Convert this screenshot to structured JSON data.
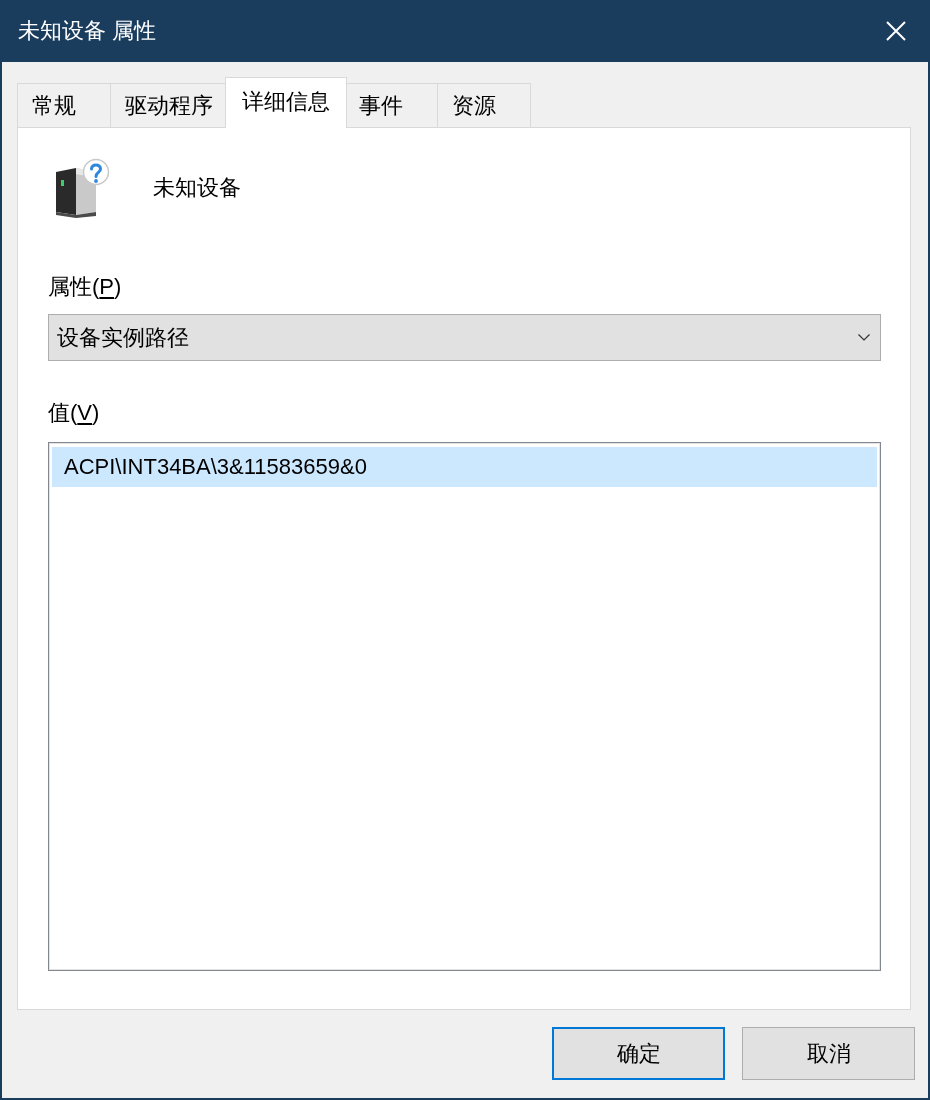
{
  "window": {
    "title": "未知设备 属性"
  },
  "tabs": [
    {
      "label": "常规",
      "selected": false
    },
    {
      "label": "驱动程序",
      "selected": false
    },
    {
      "label": "详细信息",
      "selected": true
    },
    {
      "label": "事件",
      "selected": false
    },
    {
      "label": "资源",
      "selected": false
    }
  ],
  "device": {
    "name": "未知设备"
  },
  "property": {
    "label": [
      {
        "kind": "plain",
        "text": "属性("
      },
      {
        "kind": "access_key",
        "text": "P"
      },
      {
        "kind": "plain",
        "text": ")"
      }
    ],
    "value": "设备实例路径"
  },
  "values": {
    "label": [
      {
        "kind": "plain",
        "text": "值("
      },
      {
        "kind": "access_key",
        "text": "V"
      },
      {
        "kind": "plain",
        "text": ")"
      }
    ],
    "items": [
      {
        "text": "ACPI\\INT34BA\\3&11583659&0",
        "selected": true
      }
    ]
  },
  "buttons": [
    {
      "label": "确定",
      "default": true
    },
    {
      "label": "取消",
      "default": false
    }
  ]
}
